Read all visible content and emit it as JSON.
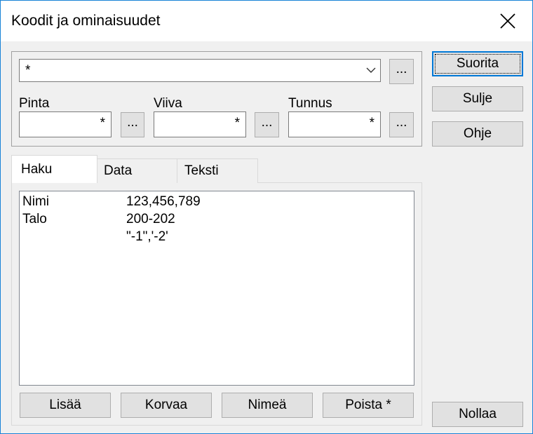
{
  "window": {
    "title": "Koodit ja ominaisuudet"
  },
  "selector": {
    "combo_value": "*",
    "browse_label": "...",
    "fields": [
      {
        "label": "Pinta",
        "value": "*",
        "browse_label": "..."
      },
      {
        "label": "Viiva",
        "value": "*",
        "browse_label": "..."
      },
      {
        "label": "Tunnus",
        "value": "*",
        "browse_label": "..."
      }
    ]
  },
  "side_buttons": {
    "run": "Suorita",
    "close": "Sulje",
    "help": "Ohje",
    "reset": "Nollaa"
  },
  "tabs": [
    {
      "label": "Haku",
      "active": true
    },
    {
      "label": "Data",
      "active": false
    },
    {
      "label": "Teksti",
      "active": false
    }
  ],
  "list": {
    "rows": [
      {
        "name": "Nimi",
        "value": "123,456,789"
      },
      {
        "name": "Talo",
        "value": "200-202"
      },
      {
        "name": "",
        "value": "\"-1\",'-2'"
      }
    ]
  },
  "list_buttons": {
    "add": "Lisää",
    "replace": "Korvaa",
    "rename": "Nimeä",
    "delete": "Poista *"
  }
}
